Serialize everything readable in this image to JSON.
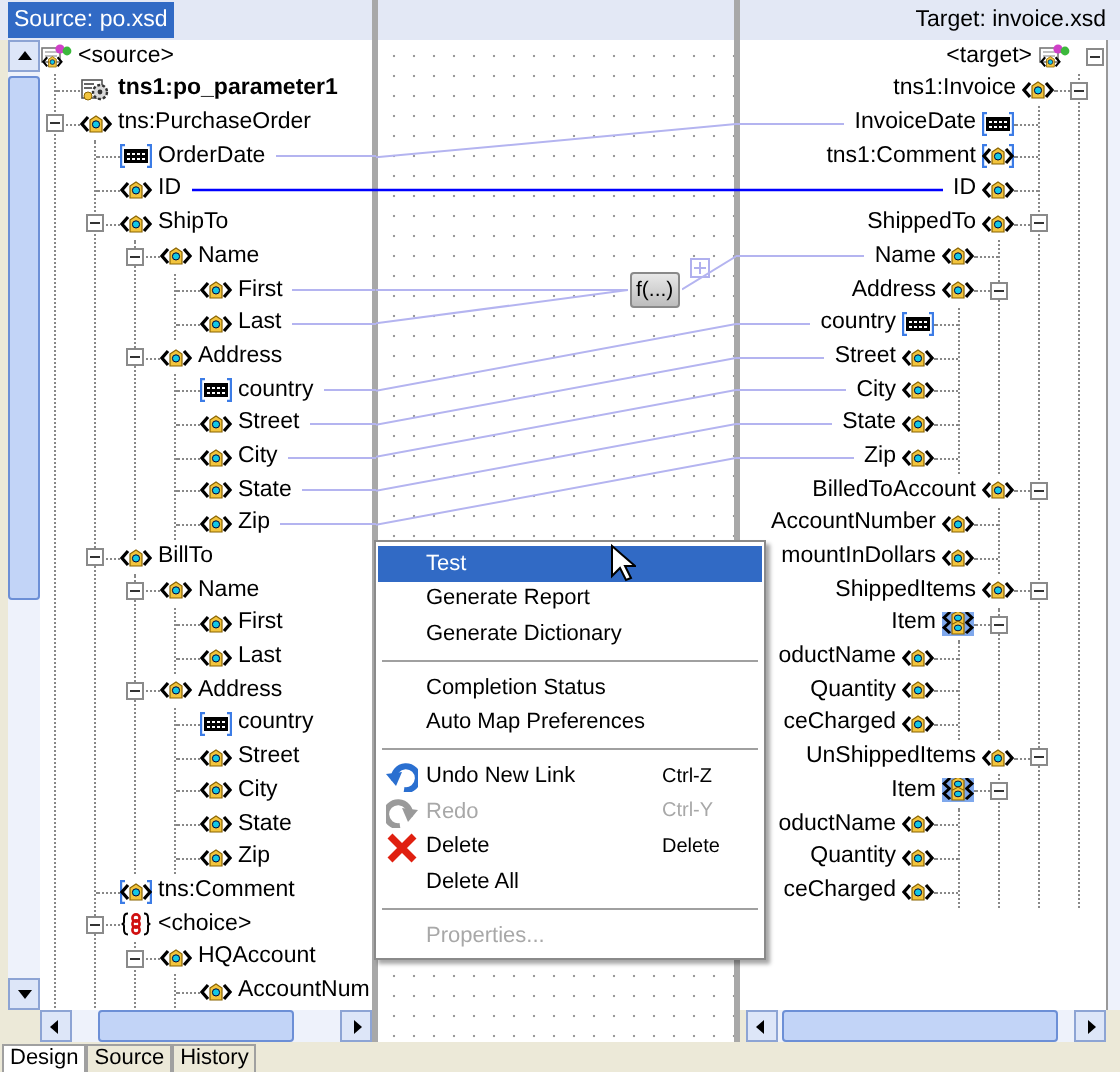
{
  "source_pane": {
    "header": {
      "label": "Source: po.xsd",
      "selected": true
    },
    "tree": [
      {
        "label": "<source>",
        "kind": "root",
        "children": [
          {
            "label": "tns1:po_parameter1",
            "kind": "parameter"
          },
          {
            "label": "tns:PurchaseOrder",
            "kind": "element",
            "expanded": true,
            "children": [
              {
                "label": "OrderDate",
                "kind": "attribute",
                "linked": true,
                "through_function": false,
                "link_selected": false
              },
              {
                "label": "ID",
                "kind": "element",
                "linked": true,
                "through_function": false,
                "link_selected": true
              },
              {
                "label": "ShipTo",
                "kind": "element",
                "expanded": true,
                "children": [
                  {
                    "label": "Name",
                    "kind": "element",
                    "expanded": true,
                    "children": [
                      {
                        "label": "First",
                        "kind": "element",
                        "linked": true,
                        "through_function": true
                      },
                      {
                        "label": "Last",
                        "kind": "element",
                        "linked": true,
                        "through_function": true
                      }
                    ]
                  },
                  {
                    "label": "Address",
                    "kind": "element",
                    "expanded": true,
                    "children": [
                      {
                        "label": "country",
                        "kind": "attribute",
                        "linked": true,
                        "through_function": false,
                        "link_selected": false
                      },
                      {
                        "label": "Street",
                        "kind": "element",
                        "linked": true,
                        "through_function": false,
                        "link_selected": false
                      },
                      {
                        "label": "City",
                        "kind": "element",
                        "linked": true,
                        "through_function": false,
                        "link_selected": false
                      },
                      {
                        "label": "State",
                        "kind": "element",
                        "linked": true,
                        "through_function": false,
                        "link_selected": false
                      },
                      {
                        "label": "Zip",
                        "kind": "element",
                        "linked": true,
                        "through_function": false,
                        "link_selected": false
                      }
                    ]
                  }
                ]
              },
              {
                "label": "BillTo",
                "kind": "element",
                "expanded": true,
                "children": [
                  {
                    "label": "Name",
                    "kind": "element",
                    "expanded": true,
                    "children": [
                      {
                        "label": "First",
                        "kind": "element"
                      },
                      {
                        "label": "Last",
                        "kind": "element"
                      }
                    ]
                  },
                  {
                    "label": "Address",
                    "kind": "element",
                    "expanded": true,
                    "children": [
                      {
                        "label": "country",
                        "kind": "attribute"
                      },
                      {
                        "label": "Street",
                        "kind": "element"
                      },
                      {
                        "label": "City",
                        "kind": "element"
                      },
                      {
                        "label": "State",
                        "kind": "element"
                      },
                      {
                        "label": "Zip",
                        "kind": "element"
                      }
                    ]
                  }
                ]
              },
              {
                "label": "tns:Comment",
                "kind": "optional-element"
              },
              {
                "label": "<choice>",
                "kind": "choice",
                "expanded": true,
                "children": [
                  {
                    "label": "HQAccount",
                    "kind": "element",
                    "expanded": true,
                    "children": [
                      {
                        "label": "AccountNum",
                        "kind": "element"
                      }
                    ]
                  }
                ]
              }
            ]
          }
        ]
      }
    ]
  },
  "target_pane": {
    "header": {
      "label": "Target: invoice.xsd",
      "selected": false
    },
    "tree": [
      {
        "label": "<target>",
        "kind": "root",
        "expanded": true,
        "children": [
          {
            "label": "tns1:Invoice",
            "kind": "element",
            "expanded": true,
            "children": [
              {
                "label": "InvoiceDate",
                "kind": "attribute",
                "linked": true,
                "through_function": false
              },
              {
                "label": "tns1:Comment",
                "kind": "optional-element"
              },
              {
                "label": "ID",
                "kind": "element",
                "linked": true,
                "through_function": false
              },
              {
                "label": "ShippedTo",
                "kind": "element",
                "expanded": true,
                "children": [
                  {
                    "label": "Name",
                    "kind": "element",
                    "linked": true,
                    "through_function": true
                  },
                  {
                    "label": "Address",
                    "kind": "element",
                    "expanded": true,
                    "children": [
                      {
                        "label": "country",
                        "kind": "attribute",
                        "linked": true,
                        "through_function": false
                      },
                      {
                        "label": "Street",
                        "kind": "element",
                        "linked": true,
                        "through_function": false
                      },
                      {
                        "label": "City",
                        "kind": "element",
                        "linked": true,
                        "through_function": false
                      },
                      {
                        "label": "State",
                        "kind": "element",
                        "linked": true,
                        "through_function": false
                      },
                      {
                        "label": "Zip",
                        "kind": "element",
                        "linked": true,
                        "through_function": false
                      }
                    ]
                  }
                ]
              },
              {
                "label": "BilledToAccount",
                "kind": "element",
                "expanded": true,
                "children": [
                  {
                    "label": "AccountNumber",
                    "kind": "element"
                  },
                  {
                    "label": "mountInDollars",
                    "kind": "element"
                  }
                ]
              },
              {
                "label": "ShippedItems",
                "kind": "element",
                "expanded": true,
                "children": [
                  {
                    "label": "Item",
                    "kind": "repeating-element",
                    "expanded": true,
                    "children": [
                      {
                        "label": "oductName",
                        "kind": "element"
                      },
                      {
                        "label": "Quantity",
                        "kind": "element"
                      },
                      {
                        "label": "ceCharged",
                        "kind": "element"
                      }
                    ]
                  }
                ]
              },
              {
                "label": "UnShippedItems",
                "kind": "element",
                "expanded": true,
                "children": [
                  {
                    "label": "Item",
                    "kind": "repeating-element",
                    "expanded": true,
                    "children": [
                      {
                        "label": "oductName",
                        "kind": "element"
                      },
                      {
                        "label": "Quantity",
                        "kind": "element"
                      },
                      {
                        "label": "ceCharged",
                        "kind": "element"
                      }
                    ]
                  }
                ]
              }
            ]
          }
        ]
      }
    ]
  },
  "function_node": {
    "label": "f(...)"
  },
  "context_menu": {
    "items": [
      {
        "kind": "item",
        "label": "Test",
        "selected": true,
        "disabled": false
      },
      {
        "kind": "item",
        "label": "Generate Report",
        "selected": false,
        "disabled": false
      },
      {
        "kind": "item",
        "label": "Generate Dictionary",
        "selected": false,
        "disabled": false
      },
      {
        "kind": "separator"
      },
      {
        "kind": "item",
        "label": "Completion Status",
        "selected": false,
        "disabled": false
      },
      {
        "kind": "item",
        "label": "Auto Map Preferences",
        "selected": false,
        "disabled": false
      },
      {
        "kind": "separator"
      },
      {
        "kind": "undo",
        "label": "Undo New Link",
        "shortcut": "Ctrl-Z",
        "selected": false,
        "disabled": false
      },
      {
        "kind": "redo",
        "label": "Redo",
        "shortcut": "Ctrl-Y",
        "selected": false,
        "disabled": true
      },
      {
        "kind": "delete",
        "label": "Delete",
        "shortcut": "Delete",
        "selected": false,
        "disabled": false
      },
      {
        "kind": "item",
        "label": "Delete All",
        "selected": false,
        "disabled": false
      },
      {
        "kind": "separator"
      },
      {
        "kind": "item",
        "label": "Properties...",
        "selected": false,
        "disabled": true
      }
    ]
  },
  "tabs": [
    {
      "label": "Design",
      "selected": true
    },
    {
      "label": "Source",
      "selected": false
    },
    {
      "label": "History",
      "selected": false
    }
  ]
}
